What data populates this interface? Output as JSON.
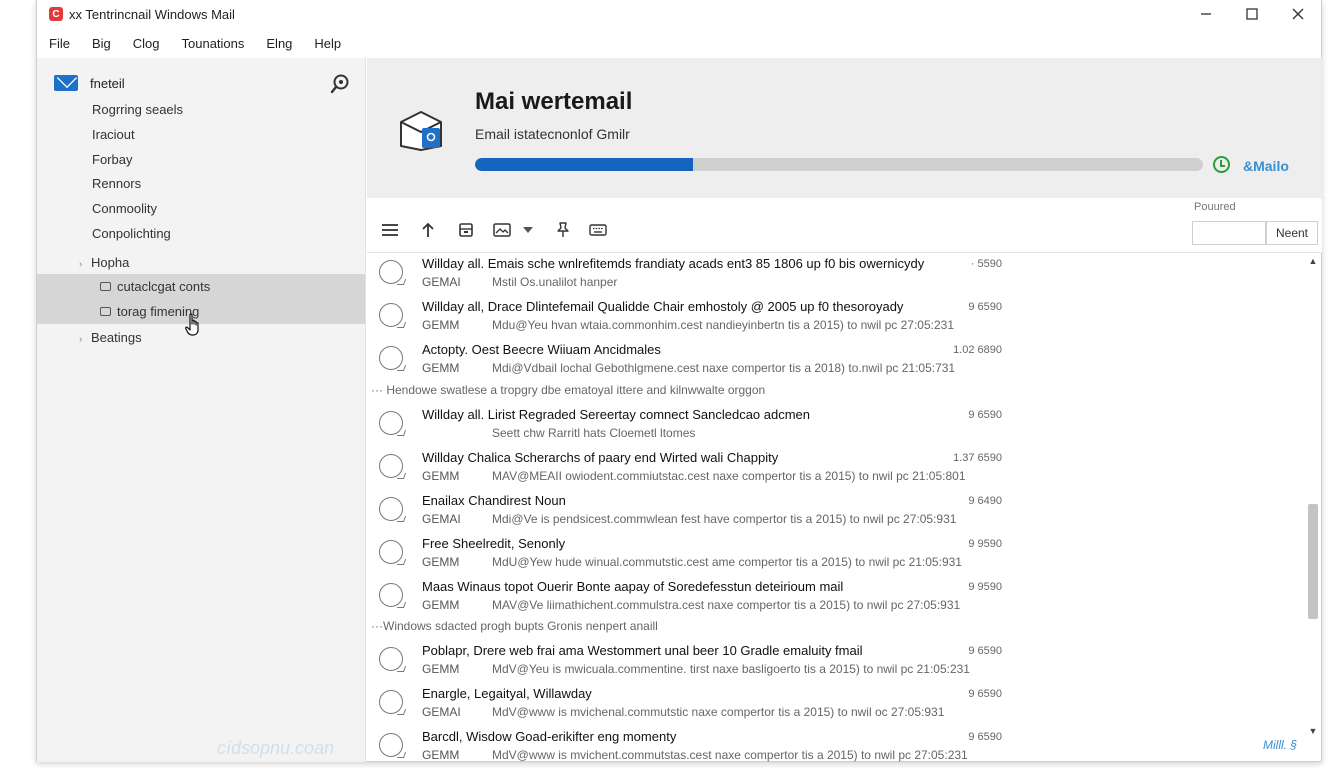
{
  "window": {
    "title": "xx Tentrincnail Windows Mail",
    "controls": {
      "minimize_icon": "minimize-icon",
      "maximize_icon": "maximize-icon",
      "close_icon": "close-icon"
    }
  },
  "menu": [
    "File",
    "Big",
    "Clog",
    "Tounations",
    "Elng",
    "Help"
  ],
  "sidebar": {
    "title": "fneteil",
    "items": [
      "Rogrring seaels",
      "Iraciout",
      "Forbay",
      "Rennors",
      "Conmoolity",
      "Conpolichting"
    ],
    "group1": {
      "label": "Hopha",
      "children": [
        "cutaclcgat conts",
        "torag fimening"
      ]
    },
    "group2": {
      "label": "Beatings"
    },
    "watermark": "cídsopnu.coan"
  },
  "header": {
    "title": "Mai wertemail",
    "subtitle": "Email istatecnonlof Gmilr",
    "progress": 0.3,
    "brand": "&Mailo"
  },
  "toolbar": {
    "search_label": "Pouured",
    "search_value": "",
    "next_label": "Neent"
  },
  "messages": [
    {
      "subject": "Willday all. Emais sche wnlrefitemds frandiaty acads ent3 85 1806 up f0 bis owernicydy",
      "size": "· 5590",
      "from": "GEMAI",
      "preview": "Mstil Os.unalilot hanper",
      "preview_offset": 0
    },
    {
      "subject": "Willday all, Drace Dlintefemail Qualidde Chair emhostoly @ 2005 up f0 thesoroyady",
      "size": "9 6590",
      "from": "GEMM",
      "preview": "Mdu@Yeu hvan wtaia.commonhim.cest nandieyinbertn tis a 2015) to nwil pc 27:05:231"
    },
    {
      "subject": "Actopty. Oest Beecre Wiiuam Ancidmales",
      "size": "1.02 6890",
      "from": "GEMM",
      "preview": "Mdi@Vdbail lochal Gebothlgmene.cest naxe compertor tis a 2018) to.nwil pc 21:05:731"
    },
    {
      "subject": "Willday all. Lirist Regraded Sereertay comnect Sancledcao adcmen",
      "size": "9 6590",
      "from": "",
      "preview": "Seett chw Rarritl hats Cloemetl ltomes"
    },
    {
      "subject": "Willday Chalica Scherarchs of paary end Wirted wali Chappity",
      "size": "1.37 6590",
      "from": "GEMM",
      "preview": "MAV@MEAII owiodent.commiutstac.cest naxe compertor tis a 2015) to nwil pc 21:05:801"
    },
    {
      "subject": "Enailax Chandirest Noun",
      "size": "9 6490",
      "from": "GEMAI",
      "preview": "Mdi@Ve is pendsicest.commwlean fest have compertor tis a 2015) to nwil pc 27:05:931"
    },
    {
      "subject": "Free Sheelredit, Senonly",
      "size": "9 9590",
      "from": "GEMM",
      "preview": "MdU@Yew hude winual.commutstic.cest ame compertor tis a 2015) to nwil pc 21:05:931"
    },
    {
      "subject": "Maas Winaus topot Ouerir Bonte aapay of Soredefesstun deteirioum mail",
      "size": "9 9590",
      "from": "GEMM",
      "preview": "MAV@Ve liimathichent.commulstra.cest naxe compertor tis a 2015) to nwil pc 27:05:931"
    },
    {
      "subject": "Poblapr, Drere web frai ama Westommert unal beer 10 Gradle emaluity fmail",
      "size": "9 6590",
      "from": "GEMM",
      "preview": "MdV@Yeu is mwicuala.commentine. tirst naxe basligoerto tis a 2015) to nwil pc 21:05:231"
    },
    {
      "subject": "Enargle, Legaityal, Willawday",
      "size": "9 6590",
      "from": "GEMAI",
      "preview": "MdV@www is mvichenal.commutstic naxe compertor tis a 2015) to nwil oc 27:05:931"
    },
    {
      "subject": "Barcdl, Wisdow Goad-erikifter eng momenty",
      "size": "9 6590",
      "from": "GEMM",
      "preview": "MdV@www is mvichent.commutstas.cest naxe compertor tis a 2015) to nwil pc 27:05:231"
    }
  ],
  "separators": [
    "··· Hendowe swatlese a tropgry dbe ematoyal ittere and kilnwwalte orggon",
    "···Windows sdacted progh bupts Gronis nenpert anaill"
  ],
  "footer_brand": "Milll. §"
}
